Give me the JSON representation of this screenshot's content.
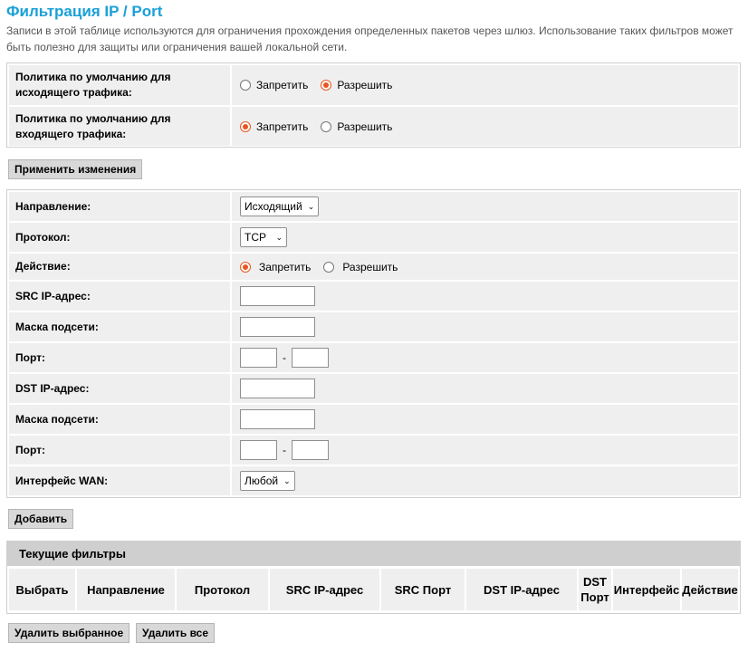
{
  "page": {
    "title": "Фильтрация IP / Port",
    "description": "Записи в этой таблице используются для ограничения прохождения определенных пакетов через шлюз. Использование таких фильтров может быть полезно для защиты или ограничения вашей локальной сети."
  },
  "policy": {
    "outgoing_label": "Политика по умолчанию для исходящего трафика:",
    "incoming_label": "Политика по умолчанию для входящего трафика:",
    "deny_label": "Запретить",
    "allow_label": "Разрешить",
    "outgoing_selected": "allow",
    "incoming_selected": "deny",
    "apply_button": "Применить изменения"
  },
  "form": {
    "direction_label": "Направление:",
    "direction_value": "Исходящий",
    "protocol_label": "Протокол:",
    "protocol_value": "TCP",
    "action_label": "Действие:",
    "action_deny": "Запретить",
    "action_allow": "Разрешить",
    "action_selected": "deny",
    "src_ip_label": "SRC IP-адрес:",
    "src_mask_label": "Маска подсети:",
    "src_port_label": "Порт:",
    "dst_ip_label": "DST IP-адрес:",
    "dst_mask_label": "Маска подсети:",
    "dst_port_label": "Порт:",
    "port_separator": "-",
    "wan_label": "Интерфейс WAN:",
    "wan_value": "Любой",
    "add_button": "Добавить"
  },
  "filters": {
    "heading": "Текущие фильтры",
    "columns": [
      "Выбрать",
      "Направление",
      "Протокол",
      "SRC IP-адрес",
      "SRC Порт",
      "DST IP-адрес",
      "DST Порт",
      "Интерфейс",
      "Действие"
    ],
    "rows": []
  },
  "actions": {
    "delete_selected": "Удалить выбранное",
    "delete_all": "Удалить все"
  },
  "colors": {
    "title": "#1aa0d8",
    "radio_selected": "#e8561f",
    "row_bg": "#efefef",
    "header_bg": "#cfcfcf"
  }
}
